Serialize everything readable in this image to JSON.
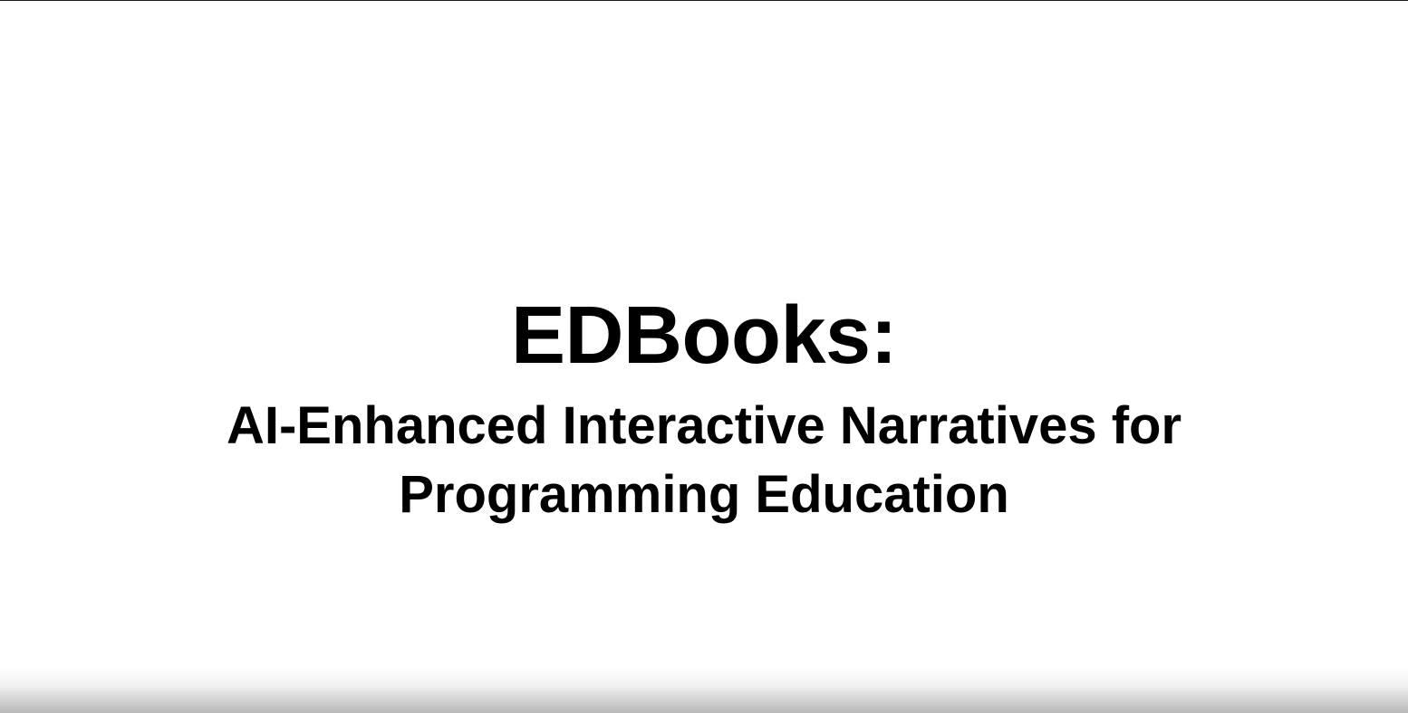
{
  "slide": {
    "title": "EDBooks:",
    "subtitle_line1": "AI-Enhanced Interactive Narratives for",
    "subtitle_line2": "Programming Education"
  },
  "colors": {
    "background": "#ffffff",
    "text": "#000000"
  }
}
